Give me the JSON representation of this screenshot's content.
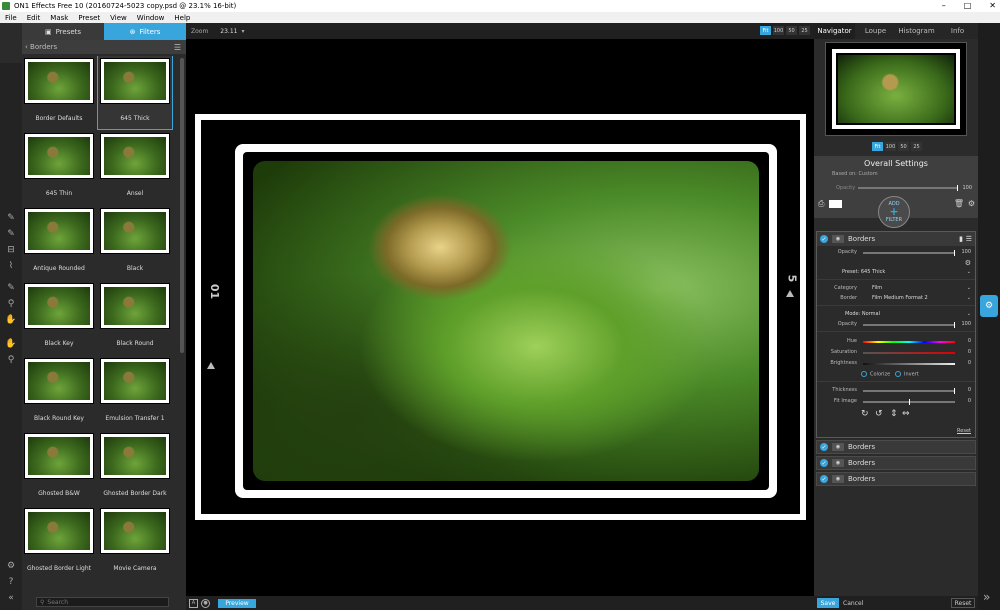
{
  "title": "ON1 Effects Free 10 (20160724-5023 copy.psd @ 23.1% 16-bit)",
  "window_controls": [
    "–",
    "□",
    "✕"
  ],
  "menu": [
    "File",
    "Edit",
    "Mask",
    "Preset",
    "View",
    "Window",
    "Help"
  ],
  "left": {
    "tabs": {
      "presets": "Presets",
      "filters": "Filters"
    },
    "breadcrumb": "Borders",
    "presets": [
      "Border Defaults",
      "645 Thick",
      "645 Thin",
      "Ansel",
      "Antique Rounded",
      "Black",
      "Black Key",
      "Black Round",
      "Black Round Key",
      "Emulsion Transfer 1",
      "Ghosted B&W",
      "Ghosted Border Dark",
      "Ghosted Border Light",
      "Movie Camera"
    ],
    "selected": "645 Thick",
    "search_placeholder": "Search"
  },
  "center": {
    "zoom_label": "Zoom",
    "zoom_value": "23.11",
    "zoom_buttons": [
      "Fit",
      "100",
      "50",
      "25"
    ],
    "film_left": "01",
    "film_right": "5",
    "preview": "Preview"
  },
  "right": {
    "tabs": [
      "Navigator",
      "Loupe",
      "Histogram",
      "Info"
    ],
    "nav_zoom": [
      "Fit",
      "100",
      "50",
      "25"
    ],
    "overall": {
      "title": "Overall Settings",
      "based": "Based on:   Custom",
      "opacity_label": "Opacity",
      "opacity": "100",
      "add_filter_top": "ADD",
      "add_filter_bottom": "FILTER"
    },
    "filter": {
      "name": "Borders",
      "opacity_label": "Opacity",
      "opacity": "100",
      "preset": "Preset: 645 Thick",
      "category_label": "Category",
      "category": "Film",
      "border_label": "Border",
      "border": "Film Medium Format 2",
      "mode": "Mode: Normal",
      "opacity2_label": "Opacity",
      "opacity2": "100",
      "hue_label": "Hue",
      "hue": "0",
      "saturation_label": "Saturation",
      "saturation": "0",
      "brightness_label": "Brightness",
      "brightness": "0",
      "colorize": "Colorize",
      "invert": "Invert",
      "thickness_label": "Thickness",
      "thickness": "0",
      "fit_label": "Fit Image",
      "fit": "0",
      "reset": "Reset"
    },
    "collapsed": [
      "Borders",
      "Borders",
      "Borders"
    ],
    "save": "Save",
    "cancel": "Cancel",
    "reset": "Reset"
  }
}
